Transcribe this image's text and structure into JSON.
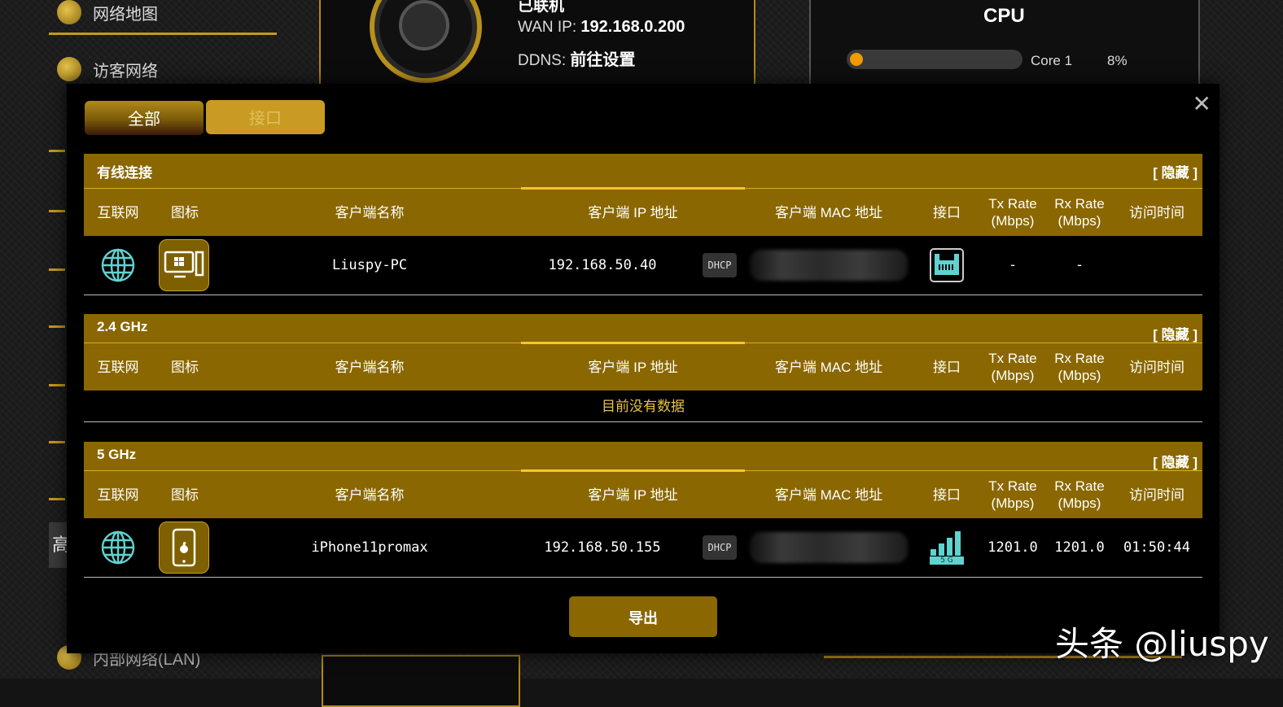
{
  "sidebar": {
    "network_map": "网络地图",
    "guest_network": "访客网络",
    "lan": "内部网络(LAN)",
    "advanced_partial": "高"
  },
  "router_status": {
    "status_partial": "已联机",
    "wan_ip_label": "WAN IP:",
    "wan_ip": "192.168.0.200",
    "ddns_label": "DDNS:",
    "ddns_value": "前往设置"
  },
  "cpu": {
    "title": "CPU",
    "core_label": "Core 1",
    "core_value": "8%",
    "usage_fraction": 0.08,
    "bar_color": "#f39a00"
  },
  "modal": {
    "close_icon": "close-icon",
    "tabs": {
      "all": "全部",
      "interface": "接口"
    },
    "columns": {
      "internet": "互联网",
      "icon": "图标",
      "client_name": "客户端名称",
      "client_ip": "客户端 IP 地址",
      "client_mac": "客户端 MAC 地址",
      "interface": "接口",
      "tx_rate_1": "Tx Rate",
      "tx_rate_2": "(Mbps)",
      "rx_rate_1": "Rx Rate",
      "rx_rate_2": "(Mbps)",
      "access_time": "访问时间"
    },
    "hide_label": "[ 隐藏 ]",
    "sections": {
      "wired": {
        "title": "有线连接",
        "client": {
          "device_icon": "windows-pc-icon",
          "name": "Liuspy-PC",
          "ip": "192.168.50.40",
          "ip_type": "DHCP",
          "interface_icon": "ethernet-icon",
          "tx": "-",
          "rx": "-",
          "time": ""
        }
      },
      "ghz24": {
        "title": "2.4 GHz",
        "empty": "目前没有数据"
      },
      "ghz5": {
        "title": "5 GHz",
        "client": {
          "device_icon": "apple-phone-icon",
          "name": "iPhone11promax",
          "ip": "192.168.50.155",
          "ip_type": "DHCP",
          "interface_icon": "wifi-5g-signal-icon",
          "band_label": "5 G",
          "tx": "1201.0",
          "rx": "1201.0",
          "time": "01:50:44"
        }
      }
    },
    "export_label": "导出"
  },
  "watermark": "头条 @liuspy",
  "colors": {
    "gold": "#8a6700",
    "gold_light": "#c99b22",
    "accent_line": "#f5c530",
    "globe": "#5fd3d0"
  }
}
